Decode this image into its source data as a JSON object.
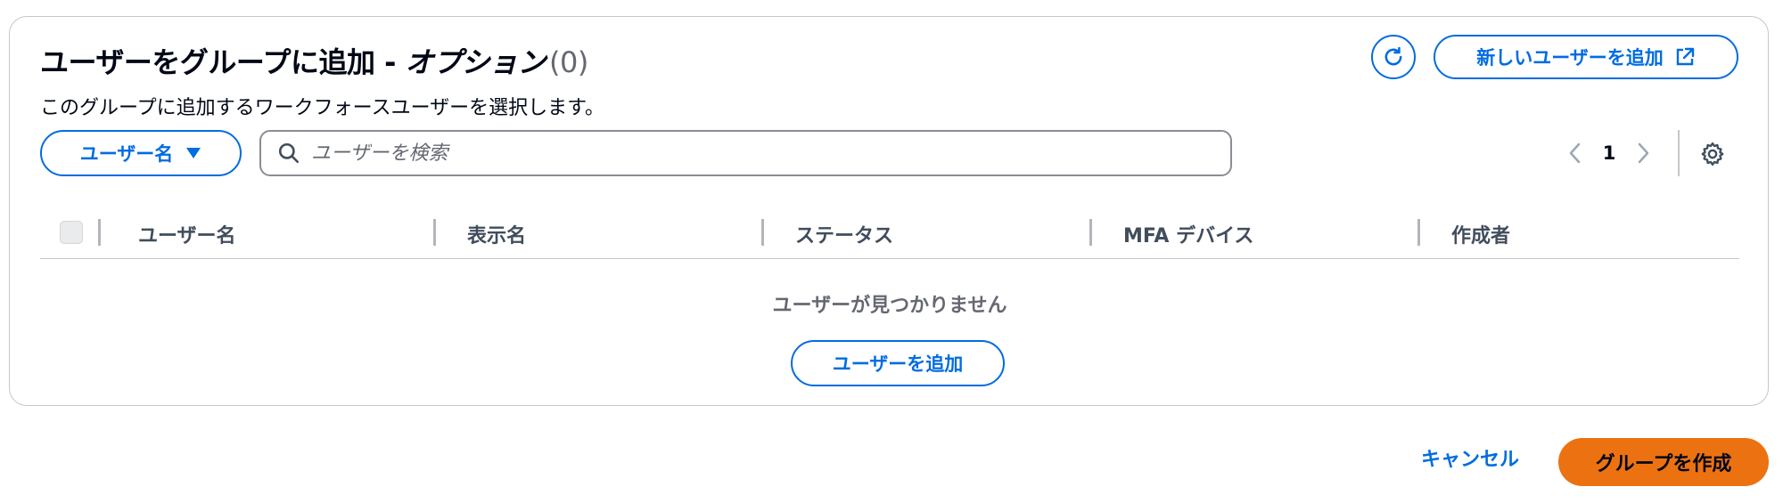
{
  "header": {
    "title_main": "ユーザーをグループに追加 - ",
    "title_italic": "オプション",
    "title_count": "(0)",
    "description": "このグループに追加するワークフォースユーザーを選択します。",
    "refresh_icon": "refresh-icon",
    "new_user_label": "新しいユーザーを追加",
    "external_link_icon": "external-link-icon"
  },
  "filter": {
    "property_label": "ユーザー名",
    "search_placeholder": "ユーザーを検索",
    "search_value": ""
  },
  "pagination": {
    "current_page": "1",
    "prev_icon": "chevron-left-icon",
    "next_icon": "chevron-right-icon",
    "settings_icon": "gear-icon"
  },
  "table": {
    "columns": [
      "ユーザー名",
      "表示名",
      "ステータス",
      "MFA デバイス",
      "作成者"
    ],
    "rows": [],
    "empty_message": "ユーザーが見つかりません",
    "empty_action_label": "ユーザーを追加"
  },
  "footer": {
    "cancel_label": "キャンセル",
    "create_label": "グループを作成"
  },
  "colors": {
    "accent": "#006ce0",
    "primary_button": "#ec7211",
    "border": "#c6c6cd"
  }
}
